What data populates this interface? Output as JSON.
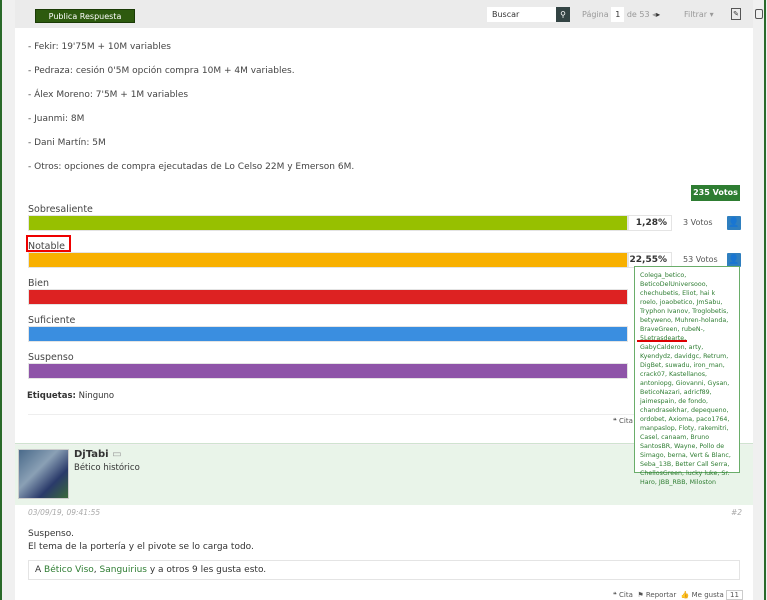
{
  "toolbar": {
    "reply": "Publica Respuesta",
    "search_placeholder": "Buscar",
    "page_label": "Página",
    "page": "1",
    "of_pages": "de 53",
    "filter": "Filtrar ▾"
  },
  "post1": {
    "lines": [
      "- Fekir: 19'75M + 10M variables",
      "- Pedraza: cesión 0'5M opción compra 10M + 4M variables.",
      "- Álex Moreno: 7'5M + 1M variables",
      "- Juanmi: 8M",
      "- Dani Martín: 5M",
      "- Otros: opciones de compra ejecutadas de Lo Celso 22M y Emerson 6M."
    ],
    "poll": {
      "total": "235 Votos",
      "options": [
        {
          "label": "Sobresaliente",
          "percent_text": "1,28%",
          "percent": 1.28,
          "votes": "3 Votos",
          "color": "#97c000"
        },
        {
          "label": "Notable",
          "percent_text": "22,55%",
          "percent": 22.55,
          "votes": "53 Votos",
          "color": "#f8b000"
        },
        {
          "label": "Bien",
          "color": "#dd2222"
        },
        {
          "label": "Suficiente",
          "color": "#3a8ee0"
        },
        {
          "label": "Suspenso",
          "color": "#8e54a8"
        }
      ]
    },
    "voters_tooltip": "Colega_betico, BeticoDelUniversooo, chechubetis, Eliot, hai k roelo, joaobetico, JmSabu, Tryphon Ivanov, Troglobetis, betyweno, Muhren-holanda, BraveGreen, rubeN-, 5Letrasdearte, GabyCalderon, arty, Kyendydz, davidgc, Retrum, DigBet, suwadu, iron_man, crack07, Kastellanos, antoniopg, Giovanni, Gysan, BeticoNazari, adricf89, jaimespain, de fondo, chandrasekhar, depequeno, ordobet, Axioma, paco1764, manpaslop, Floty, rakemitri, Casel, canaam, Bruno SantosBR, Wayne, Pollo de Simago, berna, Vert & Blanc, Seba_13B, Better Call Serra, ChellosGreen, lucky luke, Sr. Haro, JBB_RBB, Miloston",
    "tags_label": "Etiquetas:",
    "tags_value": "Ninguno",
    "quote": "Cita"
  },
  "post2": {
    "username": "DjTabi",
    "user_title": "Bético histórico",
    "date": "03/09/19, 09:41:55",
    "number": "#2",
    "message": [
      "Suspenso.",
      "El tema de la portería y el pivote se lo carga todo."
    ],
    "likes": {
      "prefix": "A",
      "user1": "Bético Viso",
      "sep": ",",
      "user2": "Sanguirius",
      "suffix": "y a otros 9 les gusta esto."
    },
    "actions": {
      "quote": "Cita",
      "report": "Reportar",
      "like": "Me gusta",
      "like_count": "11"
    }
  }
}
